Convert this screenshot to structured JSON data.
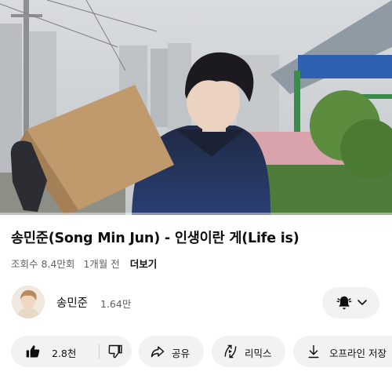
{
  "video": {
    "title": "송민준(Song Min Jun) - 인생이란 게(Life is)",
    "views": "조회수 8.4만회",
    "age": "1개월 전",
    "more_label": "더보기",
    "progress": 0.0
  },
  "channel": {
    "name": "송민준",
    "subscribers": "1.64만"
  },
  "actions": {
    "like_count": "2.8천",
    "share_label": "공유",
    "remix_label": "리믹스",
    "download_label": "오프라인 저장"
  },
  "colors": {
    "progress": "#ff0000",
    "chip_bg": "#f2f2f2",
    "text_primary": "#0f0f0f",
    "text_secondary": "#606060"
  },
  "icons": [
    "bell-icon",
    "chevron-down-icon",
    "thumbs-up-icon",
    "thumbs-down-icon",
    "share-icon",
    "remix-icon",
    "download-icon"
  ]
}
